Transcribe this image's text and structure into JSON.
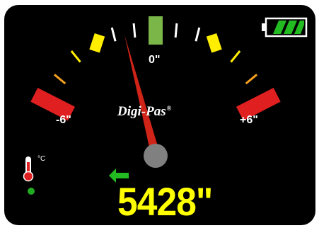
{
  "device": {
    "brand": "Digi-Pas",
    "brand_mark": "®"
  },
  "gauge": {
    "labels": {
      "left": "-6\"",
      "center": "0\"",
      "right": "+6\""
    },
    "min": -6,
    "max": 6,
    "needle_angle_deg": -13
  },
  "readout": {
    "value": "5428\""
  },
  "battery": {
    "level": 1.0,
    "color": "#22bb22"
  },
  "temperature": {
    "unit": "°C",
    "status_color": "#22aa22"
  },
  "direction_arrow": {
    "direction": "left",
    "color": "#22bb22"
  },
  "colors": {
    "background": "#000000",
    "center_mark": "#7ab648",
    "yellow": "#ffee00",
    "orange": "#f5a020",
    "red": "#e02020",
    "needle": "#d02418",
    "hub": "#808080",
    "readout": "#ffff00"
  }
}
